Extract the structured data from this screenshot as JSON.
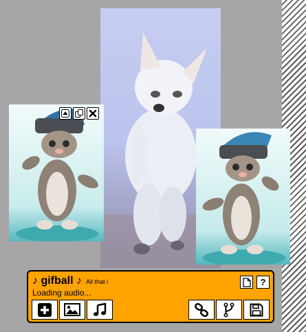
{
  "panel": {
    "title": "♪ gifball ♪",
    "tagline": "All that i",
    "status": "Loading audio...",
    "help_label": "?"
  },
  "icons": {
    "tile_controls": [
      "move-up-icon",
      "duplicate-icon",
      "close-icon"
    ],
    "top_tools": [
      "new-page-icon",
      "help-icon"
    ],
    "left_buttons": [
      "add-icon",
      "image-icon",
      "music-note-icon"
    ],
    "right_buttons": [
      "link-icon",
      "fork-icon",
      "save-icon"
    ]
  },
  "colors": {
    "panel_bg": "#ffa300",
    "page_bg": "#a6a6a6"
  }
}
